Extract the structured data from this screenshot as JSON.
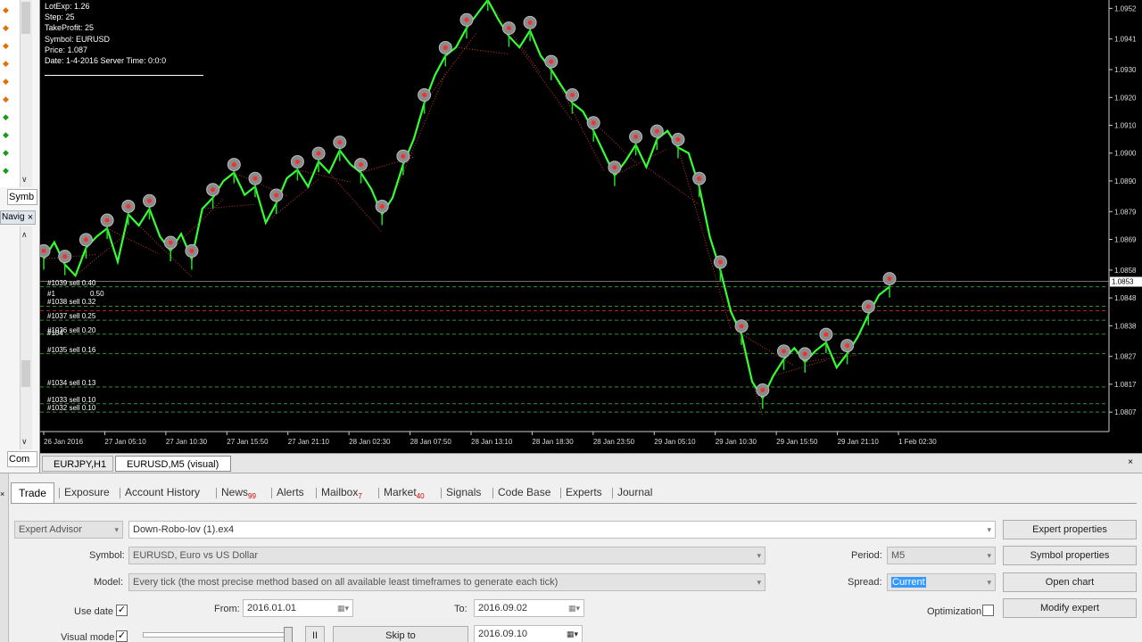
{
  "left_panel": {
    "symbols_tab": "Symb",
    "navigator_tab": "Navig",
    "common_tab": "Com",
    "close_glyph": "×"
  },
  "info": {
    "lines": [
      "LotExp: 1.26",
      "Step: 25",
      "TakeProfit: 25",
      "Symbol: EURUSD",
      "Price: 1.087",
      "Date: 1-4-2016 Server Time: 0:0:0"
    ]
  },
  "orders": [
    {
      "label": "#1039 sell 0.40",
      "price": 1.0852
    },
    {
      "label": "#1038 sell 0.32",
      "price": 1.0845
    },
    {
      "label": "#1037 sell 0.25",
      "price": 1.084
    },
    {
      "label": "#1036 sell 0.20",
      "price": 1.0835
    },
    {
      "label": "#1035 sell 0.16",
      "price": 1.0828
    },
    {
      "label": "#1034 sell 0.13",
      "price": 1.0816
    },
    {
      "label": "#1033 sell 0.10",
      "price": 1.081
    },
    {
      "label": "#1032 sell 0.10",
      "price": 1.0807
    }
  ],
  "order_labels_extra": {
    "top_label": "#1",
    "top_lot": "0.50",
    "tp_label": "#104"
  },
  "chart_data": {
    "type": "line",
    "symbol": "EURUSD,M5",
    "x_ticks": [
      "26 Jan 2016",
      "27 Jan 05:10",
      "27 Jan 10:30",
      "27 Jan 15:50",
      "27 Jan 21:10",
      "28 Jan 02:30",
      "28 Jan 07:50",
      "28 Jan 13:10",
      "28 Jan 18:30",
      "28 Jan 23:50",
      "29 Jan 05:10",
      "29 Jan 10:30",
      "29 Jan 15:50",
      "29 Jan 21:10",
      "1 Feb 02:30"
    ],
    "y_ticks": [
      "1.0952",
      "1.0941",
      "1.0930",
      "1.0920",
      "1.0910",
      "1.0900",
      "1.0890",
      "1.0879",
      "1.0869",
      "1.0858",
      "1.0848",
      "1.0838",
      "1.0827",
      "1.0817",
      "1.0807"
    ],
    "ylim": [
      1.08,
      1.0955
    ],
    "current_price": "1.0853",
    "series": [
      {
        "values": [
          1.0862,
          1.0868,
          1.086,
          1.0856,
          1.0866,
          1.087,
          1.0873,
          1.0861,
          1.0878,
          1.0874,
          1.088,
          1.087,
          1.0865,
          1.0871,
          1.0862,
          1.088,
          1.0884,
          1.089,
          1.0893,
          1.0885,
          1.0888,
          1.0875,
          1.0882,
          1.0891,
          1.0894,
          1.0888,
          1.0897,
          1.0893,
          1.0901,
          1.0896,
          1.0893,
          1.0887,
          1.0878,
          1.0884,
          1.0896,
          1.0905,
          1.0918,
          1.0928,
          1.0935,
          1.0938,
          1.0945,
          1.095,
          1.0955,
          1.0948,
          1.0942,
          1.0938,
          1.0944,
          1.0935,
          1.093,
          1.0924,
          1.0918,
          1.0915,
          1.0908,
          1.09,
          1.0892,
          1.0897,
          1.0903,
          1.0895,
          1.0905,
          1.0908,
          1.0902,
          1.09,
          1.0888,
          1.087,
          1.0858,
          1.0843,
          1.0835,
          1.0818,
          1.0812,
          1.082,
          1.0826,
          1.083,
          1.0825,
          1.0829,
          1.0832,
          1.0823,
          1.0828,
          1.0834,
          1.0842,
          1.0849,
          1.0852
        ]
      }
    ]
  },
  "chart_tabs": [
    "EURJPY,H1",
    "EURUSD,M5 (visual)"
  ],
  "terminal": {
    "tabs": [
      {
        "label": "Trade",
        "badge": ""
      },
      {
        "label": "Exposure",
        "badge": ""
      },
      {
        "label": "Account History",
        "badge": ""
      },
      {
        "label": "News",
        "badge": "99"
      },
      {
        "label": "Alerts",
        "badge": ""
      },
      {
        "label": "Mailbox",
        "badge": "7"
      },
      {
        "label": "Market",
        "badge": "40"
      },
      {
        "label": "Signals",
        "badge": ""
      },
      {
        "label": "Code Base",
        "badge": ""
      },
      {
        "label": "Experts",
        "badge": ""
      },
      {
        "label": "Journal",
        "badge": ""
      }
    ],
    "tester": {
      "type_value": "Expert Advisor",
      "ea_value": "Down-Robo-lov (1).ex4",
      "symbol_label": "Symbol:",
      "symbol_value": "EURUSD, Euro vs US Dollar",
      "model_label": "Model:",
      "model_value": "Every tick (the most precise method based on all available least timeframes to generate each tick)",
      "use_date_label": "Use date",
      "from_label": "From:",
      "from_value": "2016.01.01",
      "to_label": "To:",
      "to_value": "2016.09.02",
      "visual_label": "Visual mode",
      "skip_to_label": "Skip to",
      "skip_date": "2016.09.10",
      "pause_glyph": "II",
      "period_label": "Period:",
      "period_value": "M5",
      "spread_label": "Spread:",
      "spread_value": "Current",
      "optimization_label": "Optimization",
      "check_glyph": "✓",
      "buttons": {
        "expert_properties": "Expert properties",
        "symbol_properties": "Symbol properties",
        "open_chart": "Open chart",
        "modify_expert": "Modify expert"
      }
    }
  }
}
